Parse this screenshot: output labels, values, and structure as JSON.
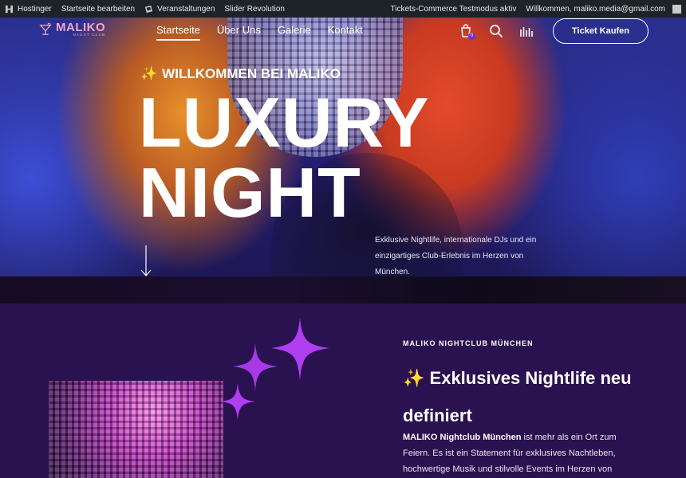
{
  "adminbar": {
    "site": "Hostinger",
    "edit": "Startseite bearbeiten",
    "events": "Veranstaltungen",
    "slider": "Slider Revolution",
    "status": "Tickets-Commerce Testmodus aktiv",
    "user": "Willkommen, maliko.media@gmail.com"
  },
  "nav": {
    "logo_name": "MALIKO",
    "logo_sub": "NACHT CLUB",
    "items": [
      "Startseite",
      "Über Uns",
      "Galerie",
      "Kontakt"
    ],
    "cart_count": "0",
    "ticket_button": "Ticket Kaufen"
  },
  "hero": {
    "welcome_emoji": "✨",
    "welcome": "WILLKOMMEN BEI MALIKO",
    "headline_line1": "LUXURY",
    "headline_line2": "NIGHT",
    "description": "Exklusive Nightlife, internationale DJs und ein einzigartiges Club-Erlebnis im Herzen von München."
  },
  "section": {
    "kicker": "MALIKO NIGHTCLUB MÜNCHEN",
    "title_emoji": "✨",
    "title": "Exklusives Nightlife neu definiert",
    "text_bold": "MALIKO Nightclub München",
    "text": " ist mehr als ein Ort zum Feiern. Es ist ein Statement für exklusives Nachtleben, hochwertige Musik und stilvolle Events im Herzen von"
  },
  "colors": {
    "adminbar": "#1d2327",
    "section_bg": "#2a1150",
    "accent_pink": "#f0a6d0",
    "star_purple": "#b13df0"
  }
}
